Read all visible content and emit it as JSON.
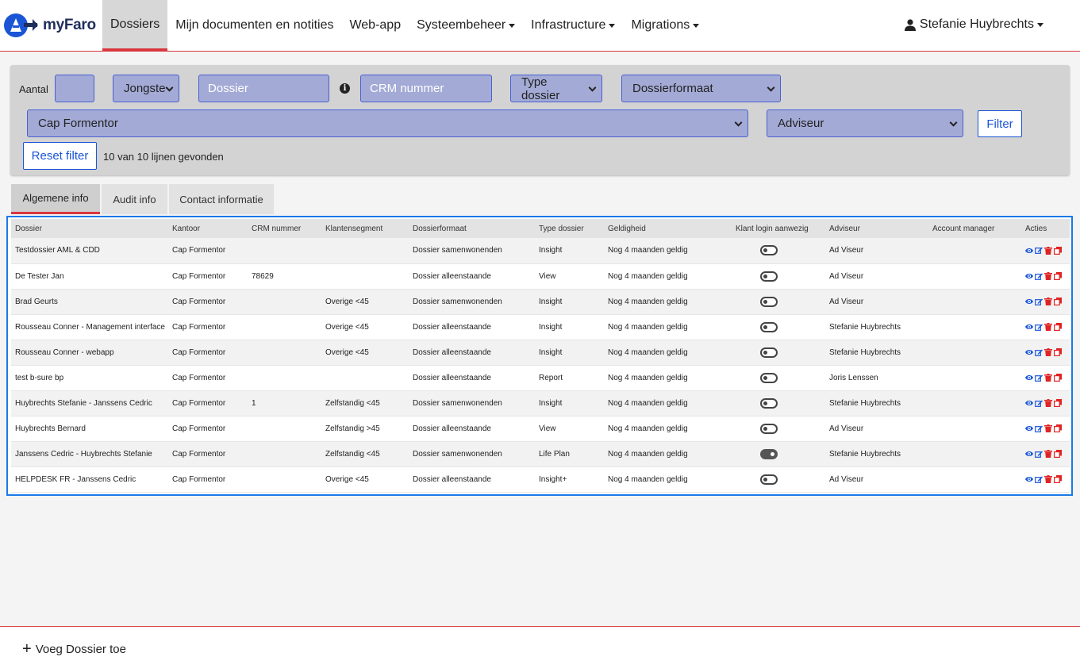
{
  "app": {
    "name": "myFaro",
    "accent": "#d9363e",
    "link": "#1a55d6"
  },
  "nav": {
    "items": [
      {
        "label": "Dossiers",
        "active": true,
        "dropdown": false
      },
      {
        "label": "Mijn documenten en notities",
        "active": false,
        "dropdown": false
      },
      {
        "label": "Web-app",
        "active": false,
        "dropdown": false
      },
      {
        "label": "Systeembeheer",
        "active": false,
        "dropdown": true
      },
      {
        "label": "Infrastructure",
        "active": false,
        "dropdown": true
      },
      {
        "label": "Migrations",
        "active": false,
        "dropdown": true
      }
    ],
    "user": "Stefanie Huybrechts"
  },
  "filter": {
    "aantal_label": "Aantal",
    "aantal_value": "",
    "sort_selected": "Jongste",
    "dossier_placeholder": "Dossier",
    "crm_placeholder": "CRM nummer",
    "type_selected": "Type dossier",
    "format_selected": "Dossierformaat",
    "kantoor_selected": "Cap Formentor",
    "adviseur_selected": "Adviseur",
    "filter_button": "Filter",
    "reset_button": "Reset filter",
    "result_text": "10 van 10 lijnen gevonden"
  },
  "tabs": [
    {
      "label": "Algemene info",
      "active": true
    },
    {
      "label": "Audit info",
      "active": false
    },
    {
      "label": "Contact informatie",
      "active": false
    }
  ],
  "table": {
    "columns": [
      "Dossier",
      "Kantoor",
      "CRM nummer",
      "Klantensegment",
      "Dossierformaat",
      "Type dossier",
      "Geldigheid",
      "Klant login aanwezig",
      "Adviseur",
      "Account manager",
      "Acties"
    ],
    "rows": [
      {
        "dossier": "Testdossier AML & CDD",
        "kantoor": "Cap Formentor",
        "crm": "",
        "segment": "",
        "formaat": "Dossier samenwonenden",
        "type": "Insight",
        "geldigheid": "Nog 4 maanden geldig",
        "login": false,
        "adviseur": "Ad Viseur",
        "manager": ""
      },
      {
        "dossier": "De Tester Jan",
        "kantoor": "Cap Formentor",
        "crm": "78629",
        "segment": "",
        "formaat": "Dossier alleenstaande",
        "type": "View",
        "geldigheid": "Nog 4 maanden geldig",
        "login": false,
        "adviseur": "Ad Viseur",
        "manager": ""
      },
      {
        "dossier": "Brad Geurts",
        "kantoor": "Cap Formentor",
        "crm": "",
        "segment": "Overige <45",
        "formaat": "Dossier samenwonenden",
        "type": "Insight",
        "geldigheid": "Nog 4 maanden geldig",
        "login": false,
        "adviseur": "Ad Viseur",
        "manager": ""
      },
      {
        "dossier": "Rousseau Conner - Management interface",
        "kantoor": "Cap Formentor",
        "crm": "",
        "segment": "Overige <45",
        "formaat": "Dossier alleenstaande",
        "type": "Insight",
        "geldigheid": "Nog 4 maanden geldig",
        "login": false,
        "adviseur": "Stefanie Huybrechts",
        "manager": ""
      },
      {
        "dossier": "Rousseau Conner - webapp",
        "kantoor": "Cap Formentor",
        "crm": "",
        "segment": "Overige <45",
        "formaat": "Dossier alleenstaande",
        "type": "Insight",
        "geldigheid": "Nog 4 maanden geldig",
        "login": false,
        "adviseur": "Stefanie Huybrechts",
        "manager": ""
      },
      {
        "dossier": "test b-sure bp",
        "kantoor": "Cap Formentor",
        "crm": "",
        "segment": "",
        "formaat": "Dossier alleenstaande",
        "type": "Report",
        "geldigheid": "Nog 4 maanden geldig",
        "login": false,
        "adviseur": "Joris Lenssen",
        "manager": ""
      },
      {
        "dossier": "Huybrechts Stefanie - Janssens Cedric",
        "kantoor": "Cap Formentor",
        "crm": "1",
        "segment": "Zelfstandig <45",
        "formaat": "Dossier samenwonenden",
        "type": "Insight",
        "geldigheid": "Nog 4 maanden geldig",
        "login": false,
        "adviseur": "Stefanie Huybrechts",
        "manager": ""
      },
      {
        "dossier": "Huybrechts Bernard",
        "kantoor": "Cap Formentor",
        "crm": "",
        "segment": "Zelfstandig >45",
        "formaat": "Dossier alleenstaande",
        "type": "View",
        "geldigheid": "Nog 4 maanden geldig",
        "login": false,
        "adviseur": "Ad Viseur",
        "manager": ""
      },
      {
        "dossier": "Janssens Cedric - Huybrechts Stefanie",
        "kantoor": "Cap Formentor",
        "crm": "",
        "segment": "Zelfstandig <45",
        "formaat": "Dossier samenwonenden",
        "type": "Life Plan",
        "geldigheid": "Nog 4 maanden geldig",
        "login": true,
        "adviseur": "Stefanie Huybrechts",
        "manager": ""
      },
      {
        "dossier": "HELPDESK FR - Janssens Cedric",
        "kantoor": "Cap Formentor",
        "crm": "",
        "segment": "Overige <45",
        "formaat": "Dossier alleenstaande",
        "type": "Insight+",
        "geldigheid": "Nog 4 maanden geldig",
        "login": false,
        "adviseur": "Ad Viseur",
        "manager": ""
      }
    ],
    "action_icons": [
      "eye-icon",
      "edit-icon",
      "trash-icon",
      "copy-icon"
    ]
  },
  "footer": {
    "add_label": "Voeg Dossier toe"
  }
}
